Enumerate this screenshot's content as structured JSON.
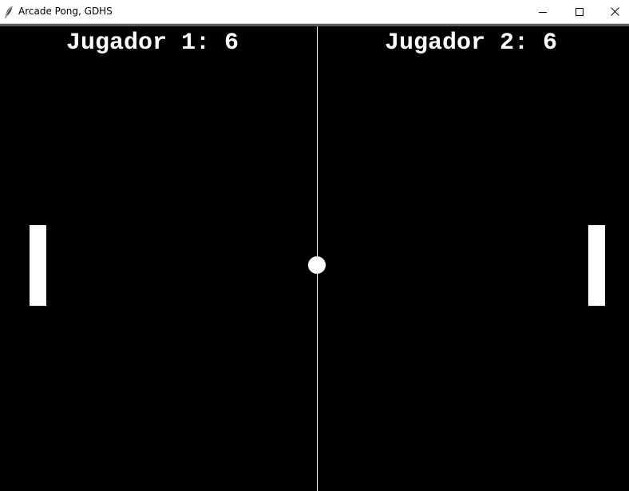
{
  "window": {
    "title": "Arcade Pong, GDHS",
    "app_icon": "feather-icon",
    "controls": [
      "minimize-icon",
      "maximize-icon",
      "close-icon"
    ]
  },
  "game": {
    "background_color": "#000000",
    "foreground_color": "#ffffff",
    "score_player_1": "Jugador 1: 6",
    "score_player_2": "Jugador 2: 6"
  }
}
